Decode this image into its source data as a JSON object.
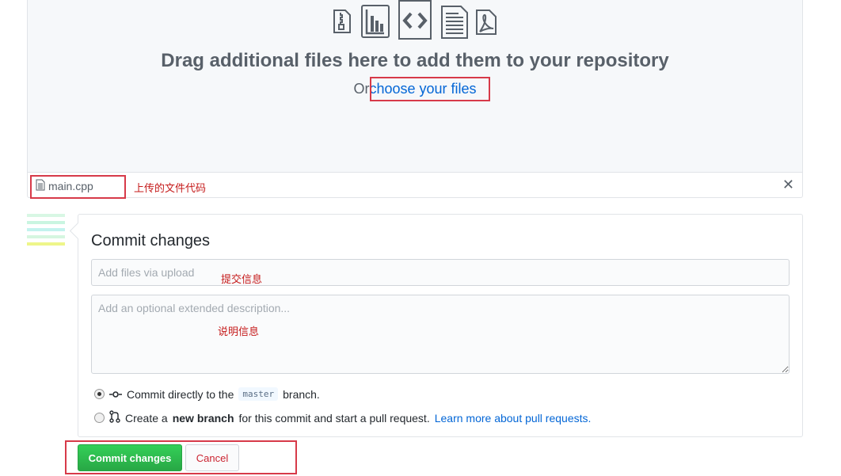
{
  "dropzone": {
    "title": "Drag additional files here to add them to your repository",
    "sub_prefix": "Or",
    "choose_link": "choose your files"
  },
  "file": {
    "name": "main.cpp",
    "annotation": "上传的文件代码"
  },
  "commit": {
    "title": "Commit changes",
    "summary_placeholder": "Add files via upload",
    "summary_annotation": "提交信息",
    "description_placeholder": "Add an optional extended description...",
    "description_annotation": "说明信息",
    "option_direct_prefix": "Commit directly to the",
    "branch": "master",
    "option_direct_suffix": "branch.",
    "option_new_prefix": "Create a",
    "option_new_bold": "new branch",
    "option_new_suffix": "for this commit and start a pull request.",
    "learn_more": "Learn more about pull requests."
  },
  "buttons": {
    "commit": "Commit changes",
    "cancel": "Cancel"
  },
  "colors": {
    "accent_red_box": "#d73a49",
    "link": "#0366d6",
    "primary_button": "#28a745"
  }
}
